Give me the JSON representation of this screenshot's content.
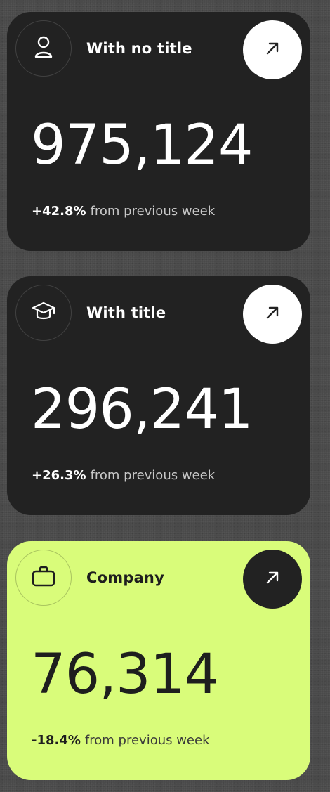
{
  "cards": [
    {
      "icon": "user-icon",
      "title": "With no title",
      "value": "975,124",
      "change": "+42.8%",
      "change_text": "from previous week",
      "theme": "dark"
    },
    {
      "icon": "graduation-cap-icon",
      "title": "With title",
      "value": "296,241",
      "change": "+26.3%",
      "change_text": "from previous week",
      "theme": "dark"
    },
    {
      "icon": "briefcase-icon",
      "title": "Company",
      "value": "76,314",
      "change": "-18.4%",
      "change_text": "from previous week",
      "theme": "lime"
    }
  ],
  "colors": {
    "background": "#4a4a4a",
    "dark_card": "#222222",
    "lime_card": "#d9fc7a",
    "white": "#ffffff"
  },
  "arrow_icon": "arrow-up-right-icon"
}
